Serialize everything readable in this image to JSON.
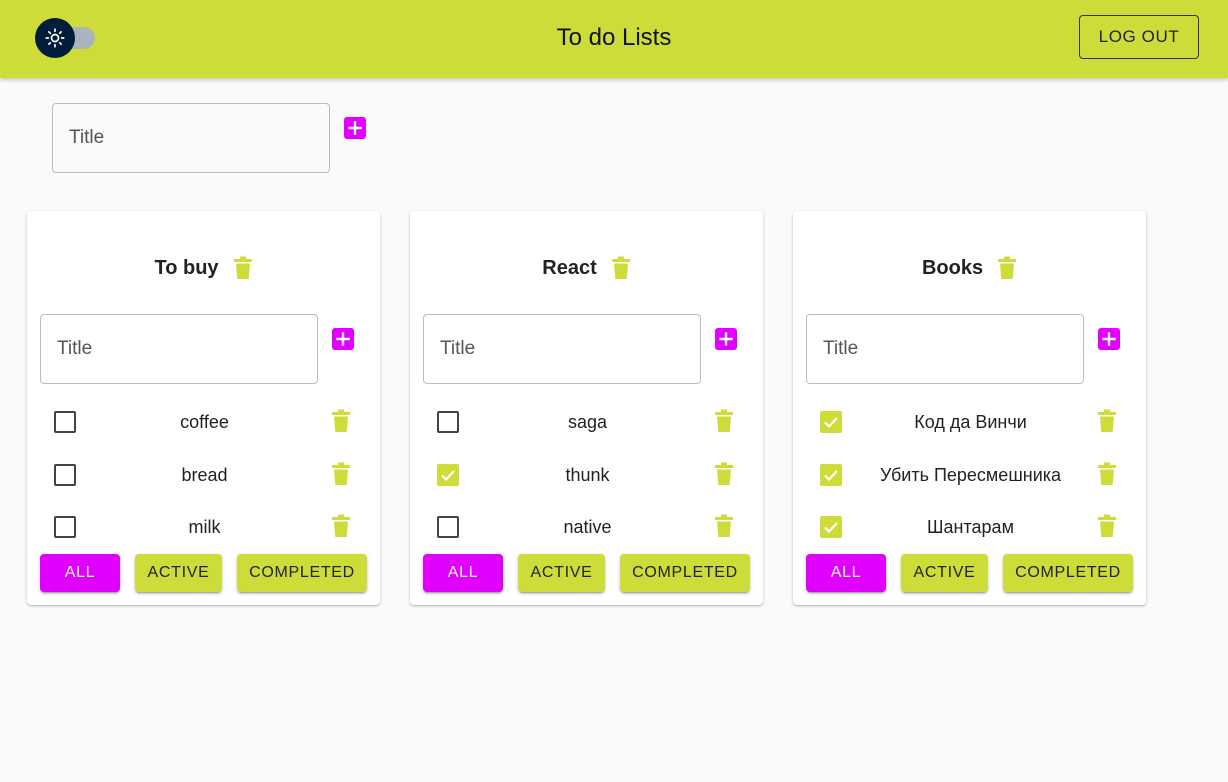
{
  "header": {
    "title": "To do Lists",
    "logout_label": "LOG OUT",
    "theme_icon": "sun-icon"
  },
  "add_list": {
    "placeholder": "Title",
    "add_icon": "plus-box-icon"
  },
  "colors": {
    "appbar": "#cddc39",
    "accent": "#e100ff",
    "trash": "#cddc39"
  },
  "lists": [
    {
      "title": "To buy",
      "placeholder": "Title",
      "tasks": [
        {
          "label": "coffee",
          "done": false
        },
        {
          "label": "bread",
          "done": false
        },
        {
          "label": "milk",
          "done": false
        }
      ],
      "filters": {
        "all": "ALL",
        "active": "ACTIVE",
        "completed": "COMPLETED",
        "selected": "ALL"
      }
    },
    {
      "title": "React",
      "placeholder": "Title",
      "tasks": [
        {
          "label": "saga",
          "done": false
        },
        {
          "label": "thunk",
          "done": true
        },
        {
          "label": "native",
          "done": false
        }
      ],
      "filters": {
        "all": "ALL",
        "active": "ACTIVE",
        "completed": "COMPLETED",
        "selected": "ALL"
      }
    },
    {
      "title": "Books",
      "placeholder": "Title",
      "tasks": [
        {
          "label": "Код да Винчи",
          "done": true
        },
        {
          "label": "Убить Пересмешника",
          "done": true
        },
        {
          "label": "Шантарам",
          "done": true
        }
      ],
      "filters": {
        "all": "ALL",
        "active": "ACTIVE",
        "completed": "COMPLETED",
        "selected": "ALL"
      }
    }
  ]
}
